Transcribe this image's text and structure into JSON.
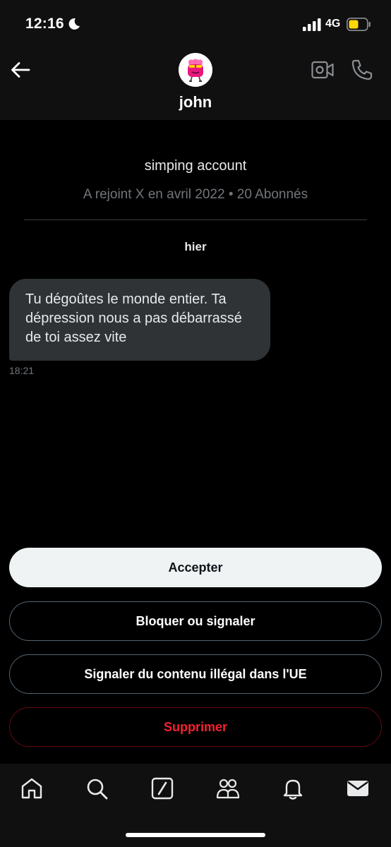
{
  "status_bar": {
    "time": "12:16",
    "network": "4G",
    "battery_color": "#ffd60a"
  },
  "header": {
    "back_icon": "arrow-left-icon",
    "contact_name": "john",
    "video_icon": "video-camera-icon",
    "phone_icon": "phone-icon"
  },
  "profile": {
    "bio": "simping account",
    "meta": "A rejoint X en avril 2022 • 20 Abonnés"
  },
  "conversation": {
    "date_separator": "hier",
    "messages": [
      {
        "text": "Tu dégoûtes le monde entier. Ta dépression nous a pas débarrassé de toi assez vite",
        "time": "18:21"
      }
    ]
  },
  "actions": {
    "accept": "Accepter",
    "block_or_report": "Bloquer ou signaler",
    "report_illegal_eu": "Signaler du contenu illégal dans l'UE",
    "delete": "Supprimer",
    "delete_color": "#f4212e"
  },
  "tab_bar": {
    "tabs": [
      "home-icon",
      "search-icon",
      "grok-icon",
      "communities-icon",
      "notifications-icon",
      "messages-icon"
    ]
  }
}
